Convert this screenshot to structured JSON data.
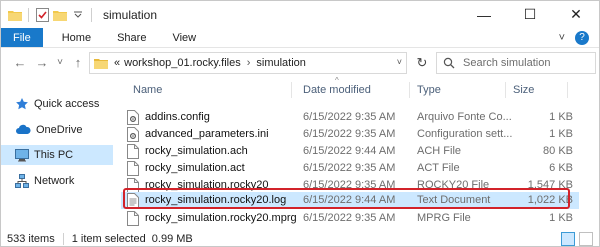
{
  "window": {
    "title": "simulation",
    "controls": {
      "minimize": "—",
      "maximize": "☐",
      "close": "✕"
    }
  },
  "ribbon": {
    "tabs": [
      "File",
      "Home",
      "Share",
      "View"
    ],
    "expand_glyph": "˅",
    "help_glyph": "?"
  },
  "address": {
    "overflow": "«",
    "crumbs": [
      "workshop_01.rocky.files",
      "simulation"
    ],
    "separator": "›",
    "dropdown": "˅",
    "refresh": "↻"
  },
  "search": {
    "placeholder": "Search simulation"
  },
  "nav": {
    "back": "←",
    "forward": "→",
    "recent": "˅",
    "up": "↑",
    "items": [
      {
        "label": "Quick access",
        "icon": "star-icon"
      },
      {
        "label": "OneDrive",
        "icon": "cloud-icon"
      },
      {
        "label": "This PC",
        "icon": "computer-icon",
        "selected": true
      },
      {
        "label": "Network",
        "icon": "network-icon"
      }
    ]
  },
  "columns": {
    "name": "Name",
    "date": "Date modified",
    "type": "Type",
    "size": "Size",
    "sort_glyph": "^"
  },
  "files": [
    {
      "name": "addins.config",
      "date": "6/15/2022 9:35 AM",
      "type": "Arquivo Fonte Co...",
      "size": "1 KB",
      "icon": "config-file-icon"
    },
    {
      "name": "advanced_parameters.ini",
      "date": "6/15/2022 9:35 AM",
      "type": "Configuration sett...",
      "size": "1 KB",
      "icon": "config-file-icon"
    },
    {
      "name": "rocky_simulation.ach",
      "date": "6/15/2022 9:44 AM",
      "type": "ACH File",
      "size": "80 KB",
      "icon": "file-icon"
    },
    {
      "name": "rocky_simulation.act",
      "date": "6/15/2022 9:35 AM",
      "type": "ACT File",
      "size": "6 KB",
      "icon": "file-icon"
    },
    {
      "name": "rocky_simulation.rocky20",
      "date": "6/15/2022 9:35 AM",
      "type": "ROCKY20 File",
      "size": "1,547 KB",
      "icon": "file-icon"
    },
    {
      "name": "rocky_simulation.rocky20.log",
      "date": "6/15/2022 9:44 AM",
      "type": "Text Document",
      "size": "1,022 KB",
      "icon": "text-file-icon",
      "selected": true
    },
    {
      "name": "rocky_simulation.rocky20.mprg",
      "date": "6/15/2022 9:35 AM",
      "type": "MPRG File",
      "size": "1 KB",
      "icon": "file-icon"
    }
  ],
  "status": {
    "count": "533 items",
    "selection": "1 item selected  0.99 MB"
  },
  "colors": {
    "accent": "#1979ca",
    "selection": "#cce8ff",
    "highlight": "#d2232a",
    "folder": "#f2c94c"
  }
}
